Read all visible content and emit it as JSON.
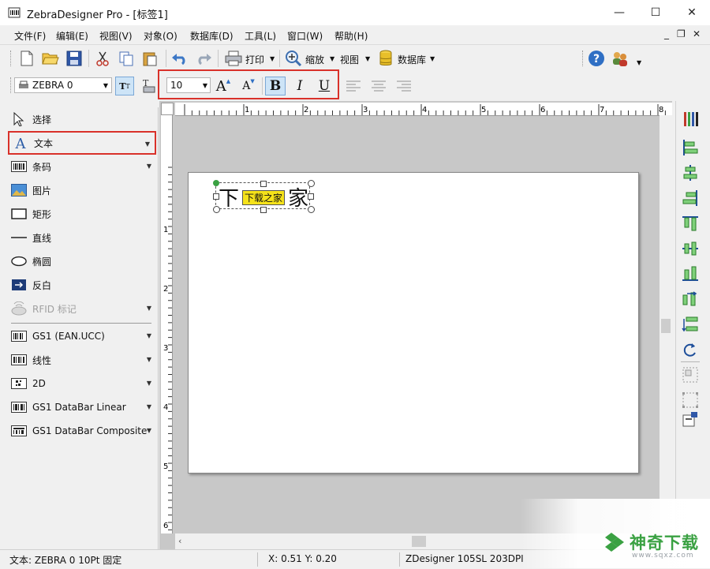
{
  "window": {
    "title": "ZebraDesigner Pro - [标签1]",
    "controls": {
      "minimize": "—",
      "maximize": "☐",
      "close": "✕"
    }
  },
  "menu": {
    "items": [
      "文件(F)",
      "编辑(E)",
      "视图(V)",
      "对象(O)",
      "数据库(D)",
      "工具(L)",
      "窗口(W)",
      "帮助(H)"
    ],
    "mdi": {
      "minimize": "_",
      "restore": "❐",
      "close": "✕"
    }
  },
  "toolbar": {
    "print_label": "打印",
    "zoom_label": "缩放",
    "view_label": "视图",
    "database_label": "数据库"
  },
  "format_toolbar": {
    "font_name": "ZEBRA 0",
    "font_size": "10",
    "bold": "B",
    "italic": "I",
    "underline": "U",
    "grow": "A",
    "shrink": "A"
  },
  "toolbox": {
    "items": [
      {
        "label": "选择",
        "icon": "cursor-icon"
      },
      {
        "label": "文本",
        "icon": "text-icon"
      },
      {
        "label": "条码",
        "icon": "barcode-icon"
      },
      {
        "label": "图片",
        "icon": "picture-icon"
      },
      {
        "label": "矩形",
        "icon": "rectangle-icon"
      },
      {
        "label": "直线",
        "icon": "line-icon"
      },
      {
        "label": "椭圆",
        "icon": "ellipse-icon"
      },
      {
        "label": "反白",
        "icon": "inverse-icon"
      },
      {
        "label": "RFID 标记",
        "icon": "rfid-icon"
      },
      {
        "label": "GS1 (EAN.UCC)",
        "icon": "gs1-icon"
      },
      {
        "label": "线性",
        "icon": "linear-barcode-icon"
      },
      {
        "label": "2D",
        "icon": "2d-barcode-icon"
      },
      {
        "label": "GS1 DataBar Linear",
        "icon": "databar-linear-icon"
      },
      {
        "label": "GS1 DataBar Composite",
        "icon": "databar-composite-icon"
      }
    ]
  },
  "rulers": {
    "horizontal": [
      "1",
      "2",
      "3",
      "4",
      "5",
      "6",
      "7",
      "8"
    ],
    "vertical": [
      "1",
      "2",
      "3",
      "4",
      "5",
      "6"
    ]
  },
  "label_canvas": {
    "text_char_1": "下",
    "text_char_4": "家",
    "overlay_badge": "下载之家"
  },
  "status": {
    "object": "文本: ZEBRA 0 10Pt 固定",
    "coords": "X: 0.51 Y: 0.20",
    "printer": "ZDesigner 105SL 203DPI"
  },
  "watermark": {
    "text": "神奇下载",
    "url": "www.sqxz.com"
  },
  "colors": {
    "highlight_red": "#d9312a",
    "accent_green": "#3aa142",
    "badge_yellow": "#f5e21a"
  }
}
